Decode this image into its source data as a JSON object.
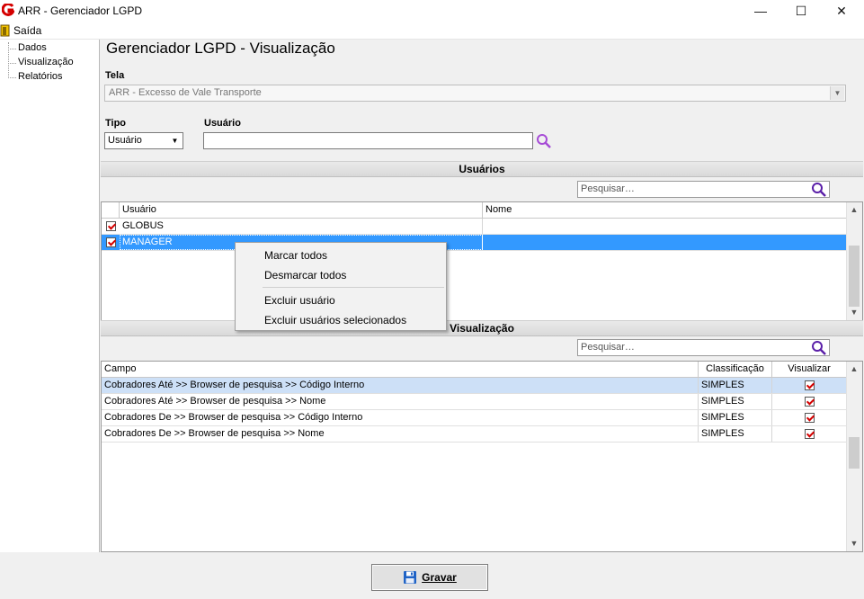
{
  "window": {
    "title": "ARR - Gerenciador LGPD",
    "minimize_glyph": "—",
    "maximize_glyph": "☐",
    "close_glyph": "✕"
  },
  "menu": {
    "saida": "Saída"
  },
  "nav": {
    "items": [
      "Dados",
      "Visualização",
      "Relatórios"
    ]
  },
  "main": {
    "title": "Gerenciador LGPD - Visualização",
    "tela_label": "Tela",
    "tela_value": "ARR - Excesso de Vale Transporte",
    "tipo_label": "Tipo",
    "tipo_value": "Usuário",
    "usuario_label": "Usuário",
    "usuario_value": ""
  },
  "usuarios": {
    "header": "Usuários",
    "search_placeholder": "Pesquisar…",
    "columns": [
      "Usuário",
      "Nome"
    ],
    "rows": [
      {
        "checked": true,
        "usuario": "GLOBUS",
        "nome": ""
      },
      {
        "checked": true,
        "usuario": "MANAGER",
        "nome": ""
      }
    ]
  },
  "context_menu": {
    "items": [
      "Marcar todos",
      "Desmarcar todos",
      "Excluir usuário",
      "Excluir usuários selecionados"
    ]
  },
  "visualizacao": {
    "header": "Visualização",
    "search_placeholder": "Pesquisar…",
    "columns": [
      "Campo",
      "Classificação",
      "Visualizar"
    ],
    "rows": [
      {
        "campo": "Cobradores Até >> Browser de pesquisa >> Código Interno",
        "classificacao": "SIMPLES",
        "visualizar": true
      },
      {
        "campo": "Cobradores Até >> Browser de pesquisa >> Nome",
        "classificacao": "SIMPLES",
        "visualizar": true
      },
      {
        "campo": "Cobradores De >> Browser de pesquisa >> Código Interno",
        "classificacao": "SIMPLES",
        "visualizar": true
      },
      {
        "campo": "Cobradores De >> Browser de pesquisa >> Nome",
        "classificacao": "SIMPLES",
        "visualizar": true
      }
    ]
  },
  "footer": {
    "save_label": "Gravar"
  },
  "colors": {
    "selection": "#3399ff",
    "selected_row_light": "#cde0f7",
    "brand_red": "#d40000",
    "search_icon": "#7a2fbf"
  }
}
